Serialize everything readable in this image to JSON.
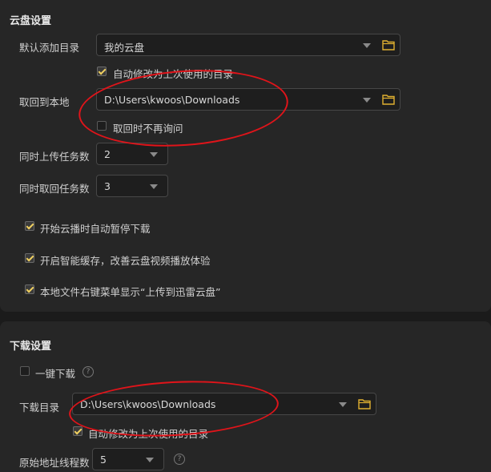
{
  "cloud": {
    "title": "云盘设置",
    "default_dir_label": "默认添加目录",
    "default_dir_value": "我的云盘",
    "auto_modify_label": "自动修改为上次使用的目录",
    "fetch_local_label": "取回到本地",
    "fetch_local_value": "D:\\Users\\kwoos\\Downloads",
    "no_ask_label": "取回时不再询问",
    "upload_tasks_label": "同时上传任务数",
    "upload_tasks_value": "2",
    "fetch_tasks_label": "同时取回任务数",
    "fetch_tasks_value": "3",
    "opt_pause_label": "开始云播时自动暂停下载",
    "opt_cache_label": "开启智能缓存，改善云盘视频播放体验",
    "opt_context_label": "本地文件右键菜单显示“上传到迅雷云盘”"
  },
  "download": {
    "title": "下载设置",
    "one_click_label": "一键下载",
    "dir_label": "下载目录",
    "dir_value": "D:\\Users\\kwoos\\Downloads",
    "auto_modify_label": "自动修改为上次使用的目录",
    "threads_label": "原始地址线程数",
    "threads_value": "5"
  },
  "icons": {
    "folder": "folder-icon",
    "caret": "chevron-down-icon",
    "help": "help-icon",
    "check": "checkmark-icon"
  },
  "colors": {
    "accent_check": "#f0d060",
    "annotation_ring": "#e0141a"
  }
}
